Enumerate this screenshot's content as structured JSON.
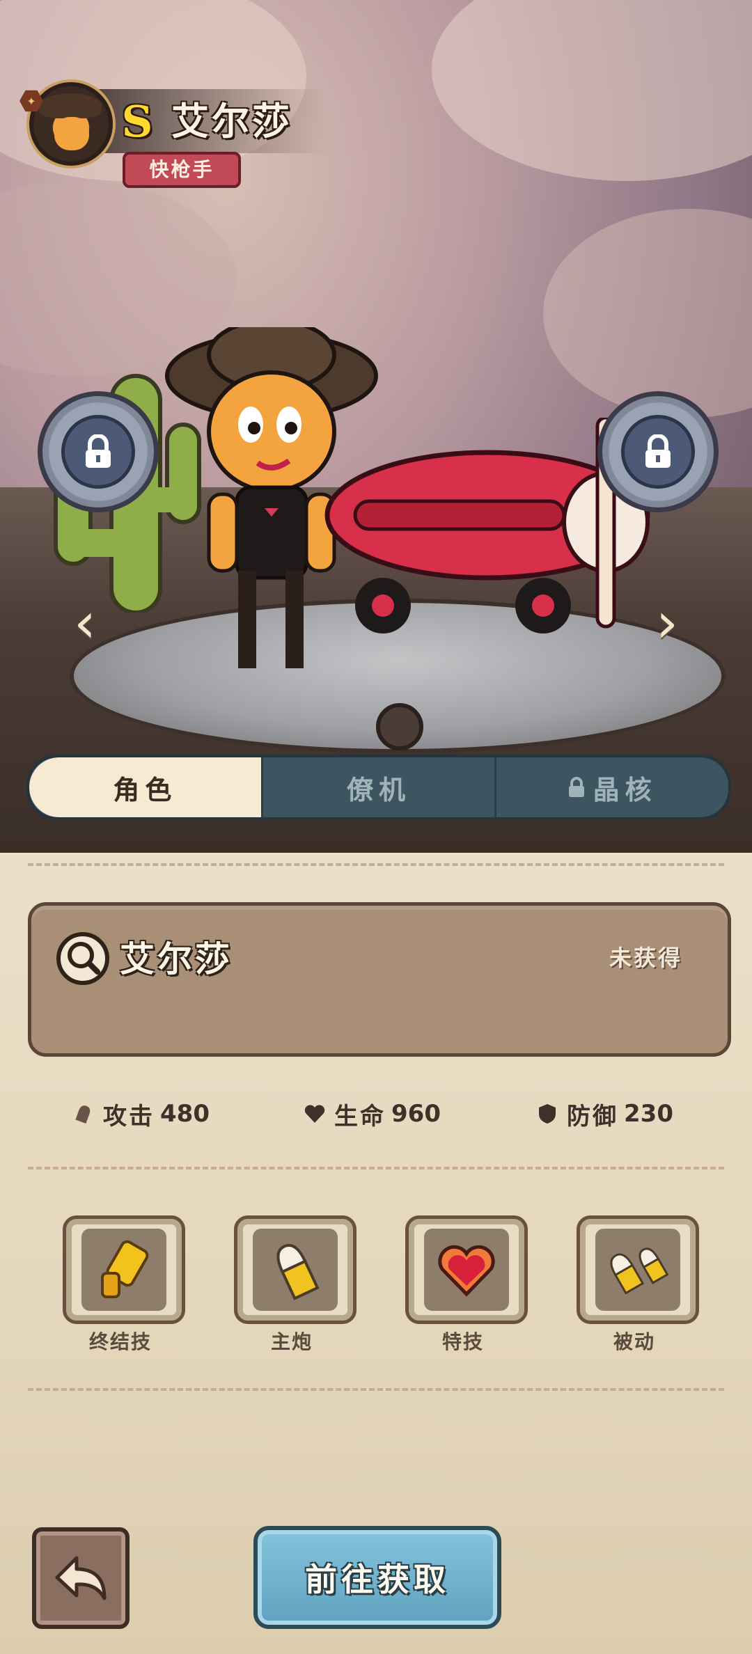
{
  "header": {
    "rank": "S",
    "hero_name": "艾尔莎",
    "role": "快枪手"
  },
  "tabs": [
    {
      "label": "角色",
      "active": true,
      "locked": false
    },
    {
      "label": "僚机",
      "active": false,
      "locked": false
    },
    {
      "label": "晶核",
      "active": false,
      "locked": true
    }
  ],
  "card": {
    "name": "艾尔莎",
    "status": "未获得"
  },
  "stats": [
    {
      "label": "攻击",
      "value": "480",
      "icon": "bullet-icon"
    },
    {
      "label": "生命",
      "value": "960",
      "icon": "heart-icon"
    },
    {
      "label": "防御",
      "value": "230",
      "icon": "shield-icon"
    }
  ],
  "skills": [
    {
      "label": "终结技",
      "icon": "gatling-gun-icon"
    },
    {
      "label": "主炮",
      "icon": "bullet-icon"
    },
    {
      "label": "特技",
      "icon": "heart-gem-icon"
    },
    {
      "label": "被动",
      "icon": "double-bullet-icon"
    }
  ],
  "actions": {
    "go_label": "前往获取"
  },
  "colors": {
    "accent_gold": "#ffd92d",
    "role_tag": "#c24a56",
    "tab_active": "#f6ead2",
    "tab_inactive": "#3d5560",
    "go_button": "#6fb1cc",
    "card_bg": "#a88f76"
  }
}
